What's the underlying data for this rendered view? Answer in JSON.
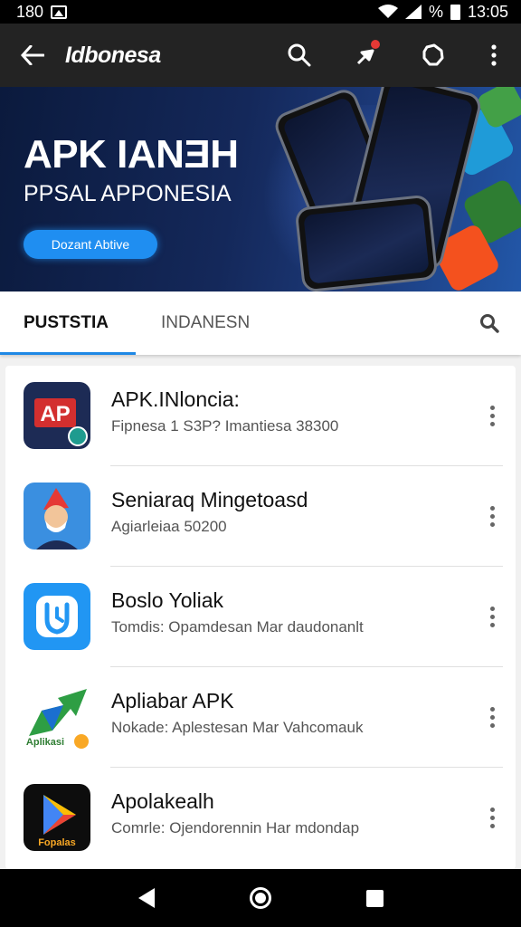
{
  "status_bar": {
    "left_text": "180",
    "battery_text": "%",
    "time": "13:05"
  },
  "app_bar": {
    "title": "Idbonesa",
    "icons": [
      "back-arrow-icon",
      "search-icon",
      "notification-icon",
      "refresh-icon",
      "more-vert-icon"
    ]
  },
  "banner": {
    "headline": "APK IANƎH",
    "subheadline": "PPSAL APPONESIA",
    "cta_label": "Dozant Abtive"
  },
  "tabs": {
    "active": "PUSTSTIA",
    "inactive": "INDANESN"
  },
  "apps": [
    {
      "title": "APK.INloncia:",
      "subtitle": "Fipnesa 1 S3P? Imantiesa 38300",
      "icon": "apk-logo-icon",
      "icon_text": "AP"
    },
    {
      "title": "Seniaraq Mingetoasd",
      "subtitle": "Agiarleiaa 50200",
      "icon": "gnome-character-icon"
    },
    {
      "title": "Boslo Yoliak",
      "subtitle": "Tomdis: Opamdesan Mar daudonanlt",
      "icon": "shield-clock-icon"
    },
    {
      "title": "Apliabar APK",
      "subtitle": "Nokade: Aplestesan Mar Vahcomauk",
      "icon": "green-arrow-icon",
      "icon_text": "Aplikasi"
    },
    {
      "title": "Apolakealh",
      "subtitle": "Comrle: Ojendorennin Har mdondap",
      "icon": "play-triangle-icon",
      "icon_text": "Fopalas"
    }
  ],
  "colors": {
    "accent": "#1e88e5",
    "app_bar": "#232323",
    "banner_dark": "#0b1a3d"
  }
}
